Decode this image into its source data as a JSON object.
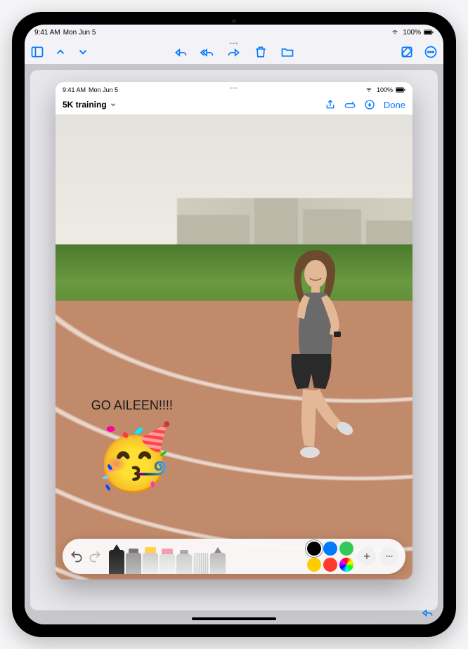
{
  "status": {
    "time": "9:41 AM",
    "date": "Mon Jun 5",
    "battery": "100%"
  },
  "outer_toolbar": {
    "sidebar": "sidebar",
    "prev": "previous",
    "next": "next",
    "reply": "reply",
    "reply_all": "reply-all",
    "forward": "forward",
    "delete": "delete",
    "move": "move",
    "compose": "compose",
    "more": "more"
  },
  "modal": {
    "status": {
      "time": "9:41 AM",
      "date": "Mon Jun 5",
      "battery": "100%"
    },
    "title": "5K training",
    "actions": {
      "share": "share",
      "markup": "markup",
      "pen_mode": "pen-mode",
      "done": "Done"
    },
    "annotation_text": "GO AILEEN!!!!",
    "emoji": "🥳"
  },
  "markup": {
    "undo": "undo",
    "redo": "redo",
    "tools": [
      {
        "name": "pen",
        "color": "#333",
        "height": 34
      },
      {
        "name": "marker",
        "color": "#888",
        "height": 30
      },
      {
        "name": "highlighter",
        "color": "#ffd24a",
        "height": 30
      },
      {
        "name": "eraser",
        "color": "#f29eb3",
        "height": 28
      },
      {
        "name": "lasso",
        "color": "#bbb",
        "height": 28
      },
      {
        "name": "ruler",
        "color": "#ddd",
        "height": 30
      },
      {
        "name": "pencil",
        "color": "#aaa",
        "height": 30
      }
    ],
    "colors": [
      {
        "hex": "#000000",
        "selected": true
      },
      {
        "hex": "#007aff",
        "selected": false
      },
      {
        "hex": "#34c759",
        "selected": false
      },
      {
        "hex": "#ffcc00",
        "selected": false
      },
      {
        "hex": "#ff3b30",
        "selected": false
      }
    ],
    "add": "add",
    "more": "more"
  }
}
